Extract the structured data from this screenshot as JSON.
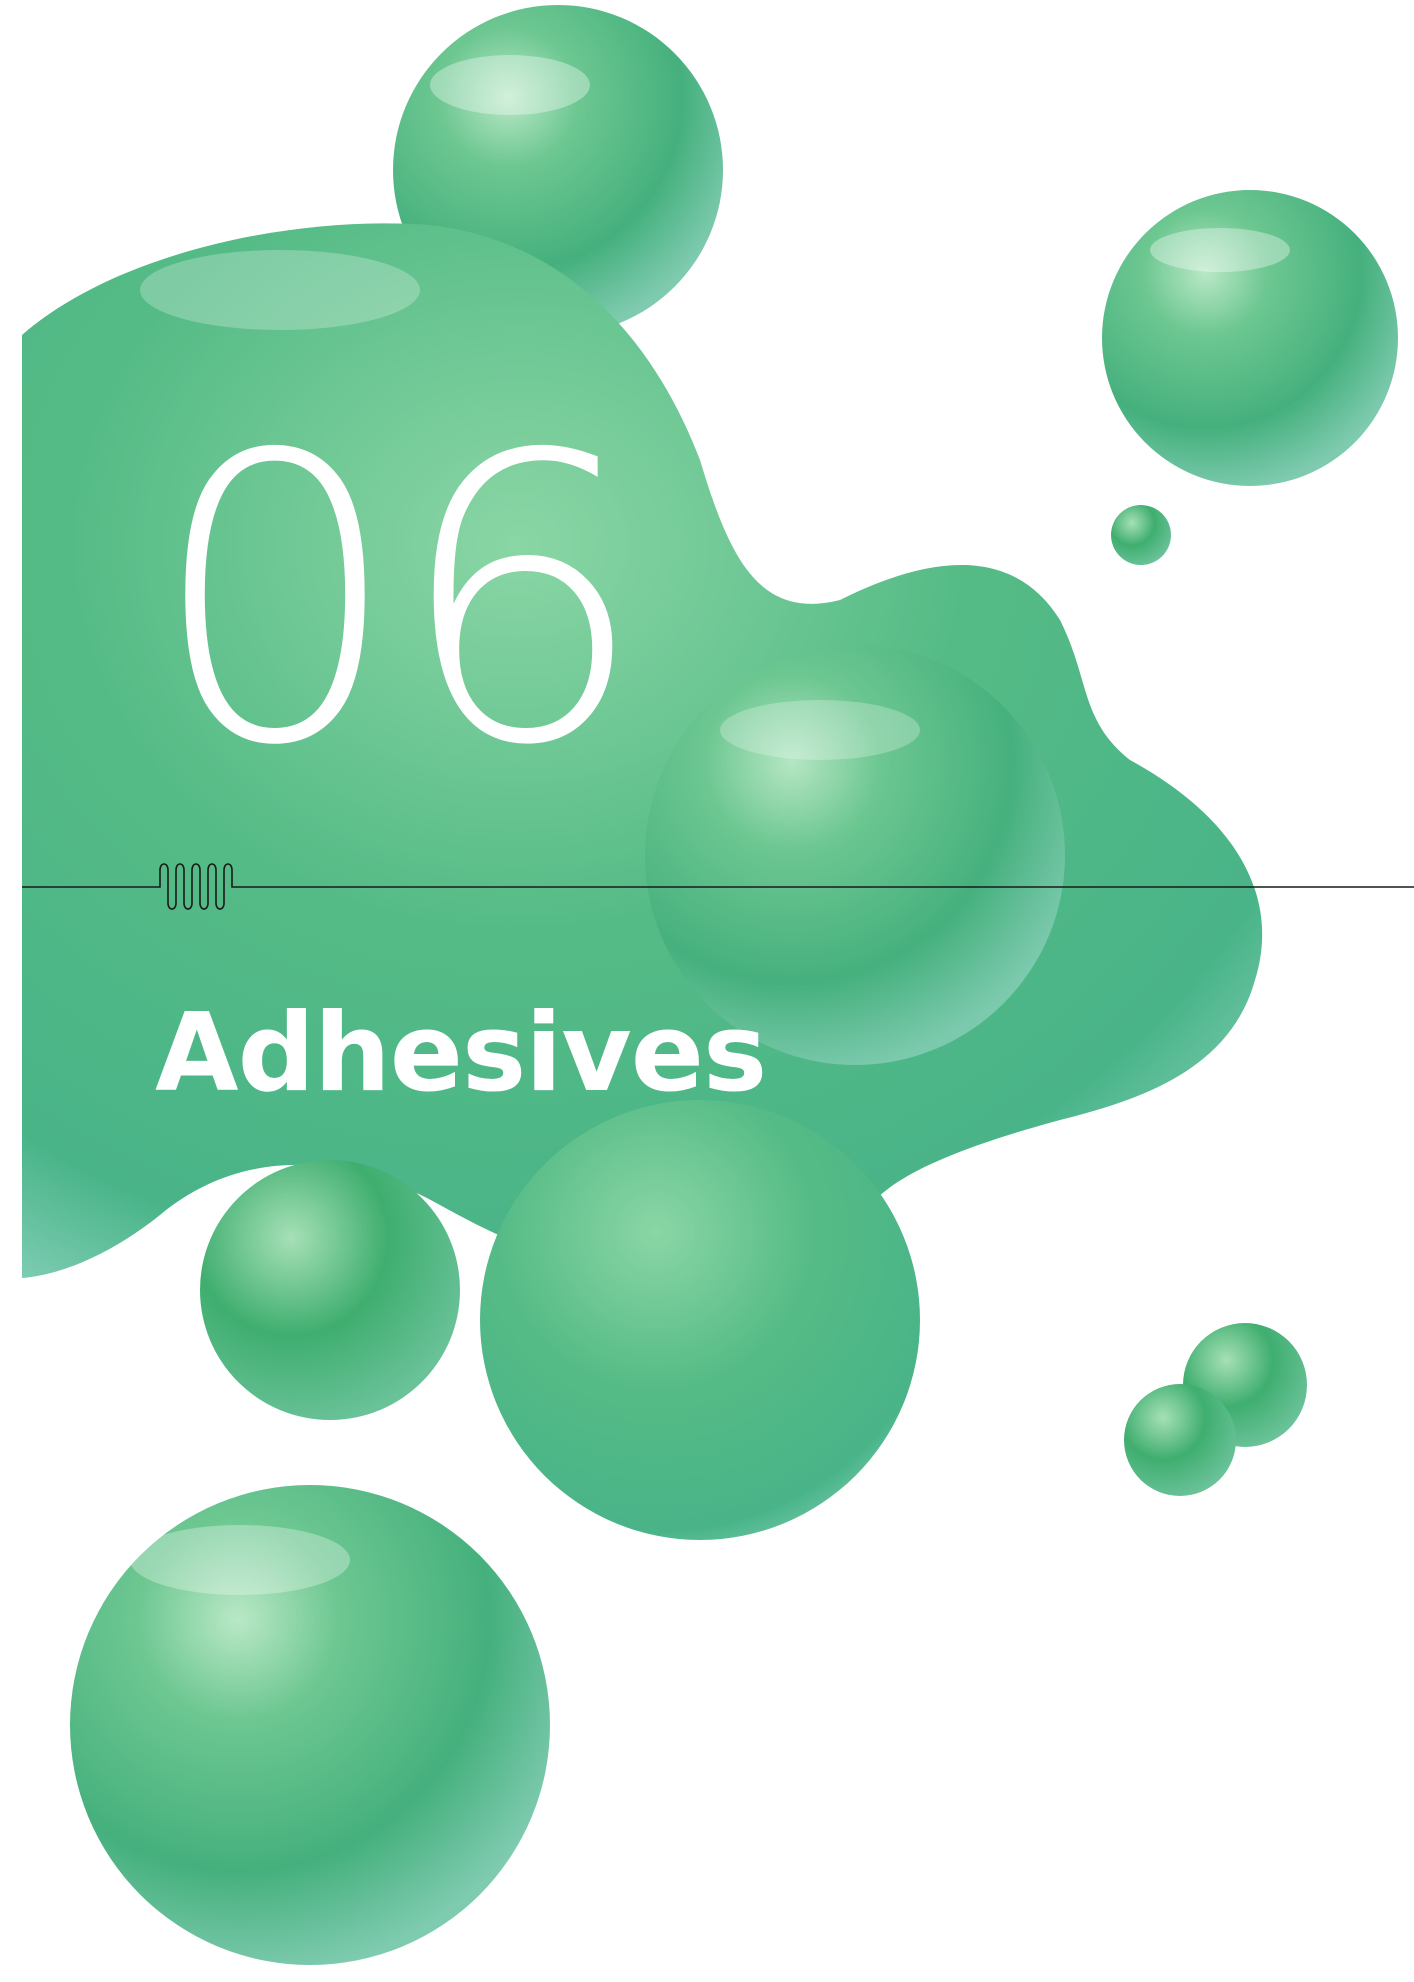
{
  "chapter": {
    "number": "06",
    "title": "Adhesives"
  },
  "colors": {
    "background": "#ffffff",
    "blob_green": "#4fb882",
    "blob_green_light": "#8fd6a8",
    "blob_green_dark": "#34a66f",
    "text": "#ffffff",
    "rule": "#1a1a1a"
  },
  "artwork": {
    "description_icon": "green-liquid-blobs-illustration"
  }
}
